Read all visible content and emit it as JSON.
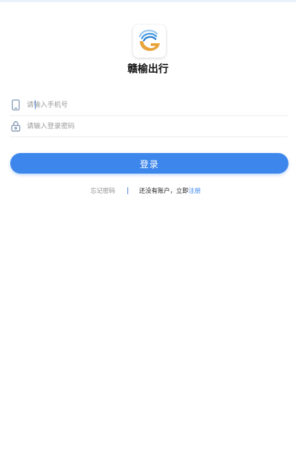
{
  "app": {
    "name": "赣榆出行"
  },
  "login_form": {
    "phone_placeholder": "请输入手机号",
    "password_placeholder": "请输入登录密码",
    "login_label": "登录"
  },
  "links": {
    "forgot_password": "忘记密码",
    "no_account_prompt": "还没有账户，立即",
    "register": "注册"
  },
  "icons": {
    "phone": "mobile-phone-icon",
    "password": "lock-icon",
    "logo": "app-logo-icon"
  },
  "colors": {
    "primary": "#3d86ec",
    "link": "#3d86ec",
    "placeholder": "#9b9b9b",
    "icon": "#6f86a8"
  }
}
